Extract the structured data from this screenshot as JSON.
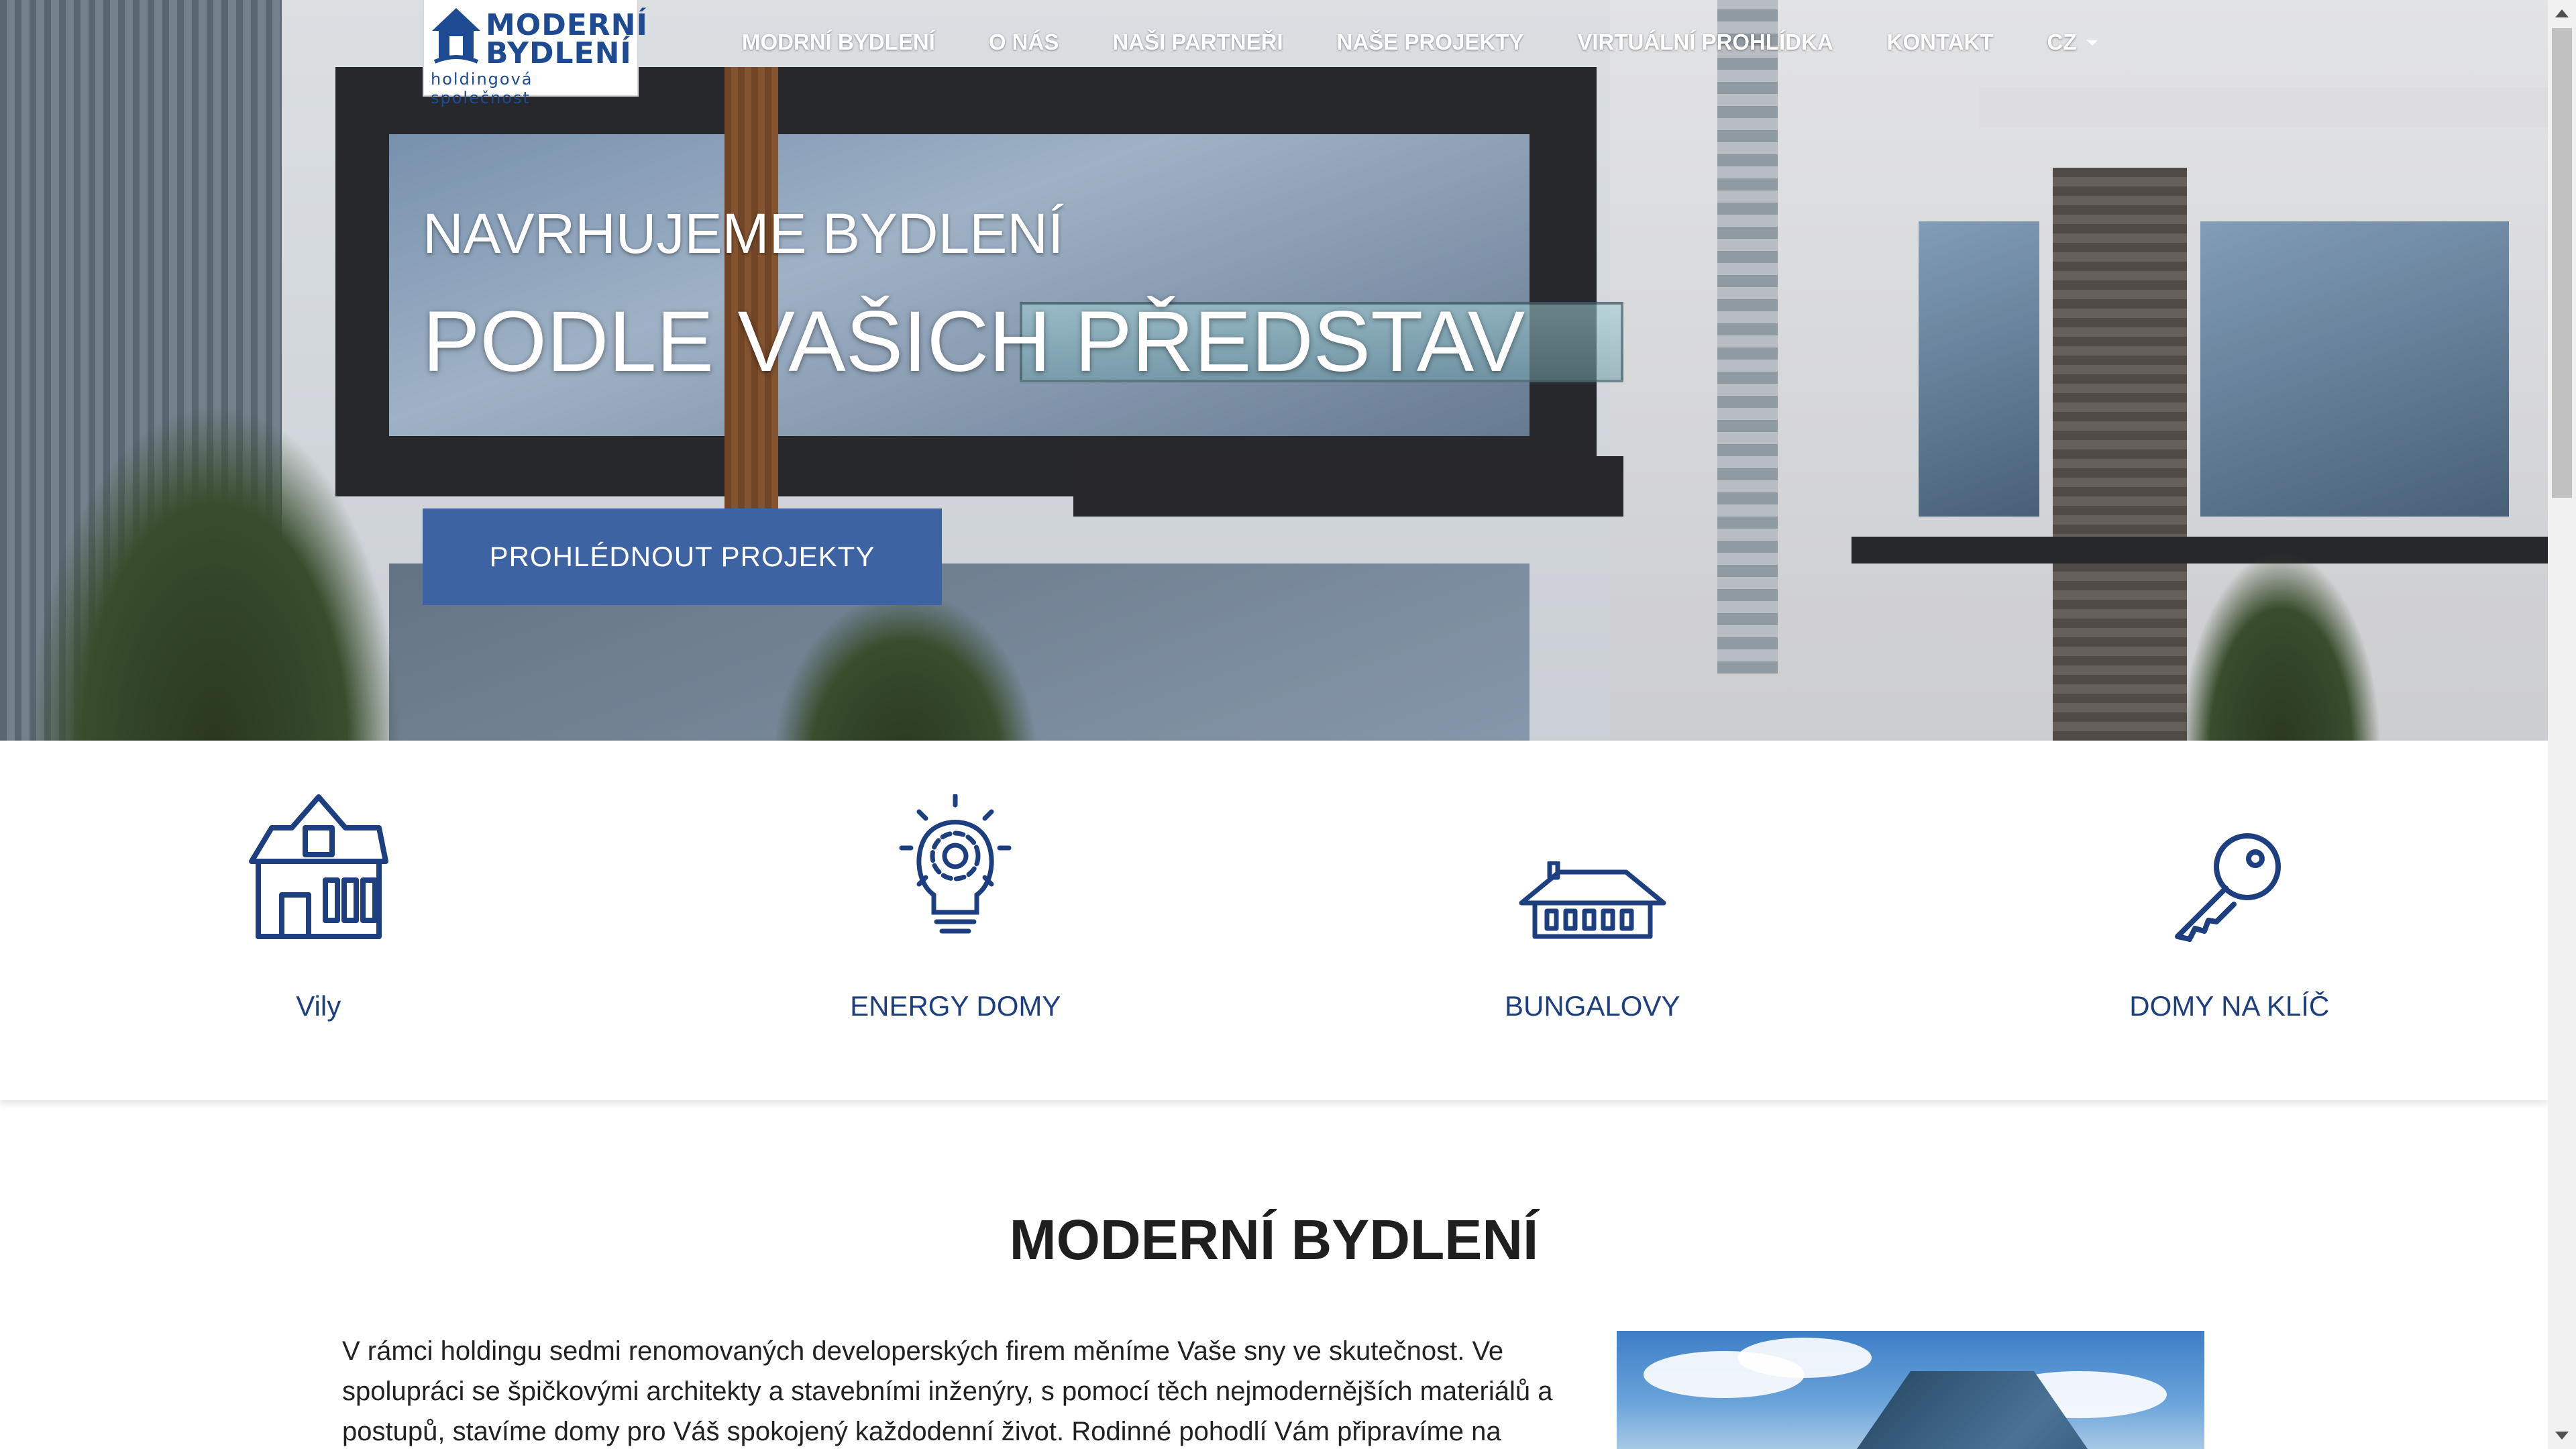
{
  "logo": {
    "line1": "MODERNÍ",
    "line2": "BYDLENÍ",
    "tagline": "holdingová společnost"
  },
  "nav": {
    "items": [
      "MODRNÍ BYDLENÍ",
      "O NÁS",
      "NAŠI PARTNEŘI",
      "NAŠE PROJEKTY",
      "VIRTUÁLNÍ PROHLÍDKA",
      "KONTAKT"
    ],
    "language": "CZ"
  },
  "hero": {
    "subtitle": "NAVRHUJEME BYDLENÍ",
    "title": "PODLE VAŠICH PŘEDSTAV",
    "cta_label": "PROHLÉDNOUT PROJEKTY"
  },
  "features": [
    {
      "label": "Vily",
      "icon": "house-icon"
    },
    {
      "label": "ENERGY DOMY",
      "icon": "lightbulb-gear-icon"
    },
    {
      "label": "BUNGALOVY",
      "icon": "bungalow-icon"
    },
    {
      "label": "DOMY NA KLÍČ",
      "icon": "key-icon"
    }
  ],
  "about": {
    "title": "MODERNÍ BYDLENÍ",
    "text": "V rámci holdingu sedmi renomovaných developerských firem měníme Vaše sny ve skutečnost. Ve spolupráci se špičkovými architekty a stavebními inženýry, s pomocí těch nejmodernějších materiálů a postupů, stavíme domy pro Váš spokojený každodenní život. Rodinné pohodlí Vám připravíme na"
  },
  "colors": {
    "accent": "#3d63a3",
    "brand_blue": "#1e4a91",
    "icon_blue": "#1e3f7f"
  }
}
